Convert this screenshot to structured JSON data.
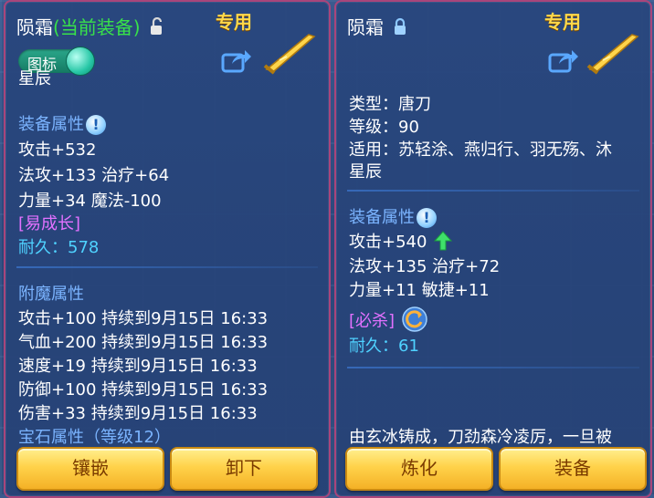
{
  "colors": {
    "accent_gold": "#ffd84a",
    "heading_blue": "#7bb4ff",
    "green": "#38e24a",
    "purple": "#e271ff",
    "cyan": "#4fd2ff",
    "frame": "#a9457b"
  },
  "left": {
    "title": "陨霜",
    "title_suffix": "(当前装备)",
    "lock_icon": "lock-open-icon",
    "badge": "专用",
    "toggle_label": "图标",
    "name_line": "星辰",
    "equip_heading": "装备属性",
    "lines": [
      "攻击+532",
      "法攻+133 治疗+64",
      "力量+34 魔法-100"
    ],
    "tag": "[易成长]",
    "durability": "耐久：578",
    "enchant_heading": "附魔属性",
    "enchant_lines": [
      "攻击+100 持续到9月15日 16:33",
      "气血+200 持续到9月15日 16:33",
      "速度+19 持续到9月15日 16:33",
      "防御+100 持续到9月15日 16:33",
      "伤害+33 持续到9月15日 16:33"
    ],
    "gem_heading": "宝石属性（等级12）",
    "btn1": "镶嵌",
    "btn2": "卸下"
  },
  "right": {
    "title": "陨霜",
    "lock_icon": "lock-closed-icon",
    "badge": "专用",
    "type_line": "类型：唐刀",
    "level_line": "等级：90",
    "usable_line1": "适用：苏轻涂、燕归行、羽无殇、沐",
    "usable_line2": "星辰",
    "equip_heading": "装备属性",
    "lines": [
      "攻击+540",
      "法攻+135 治疗+72",
      "力量+11 敏捷+11"
    ],
    "tag": "[必杀]",
    "durability": "耐久：61",
    "description": "由玄冰铸成，刀劲森冷凌厉，一旦被",
    "btn1": "炼化",
    "btn2": "装备"
  }
}
